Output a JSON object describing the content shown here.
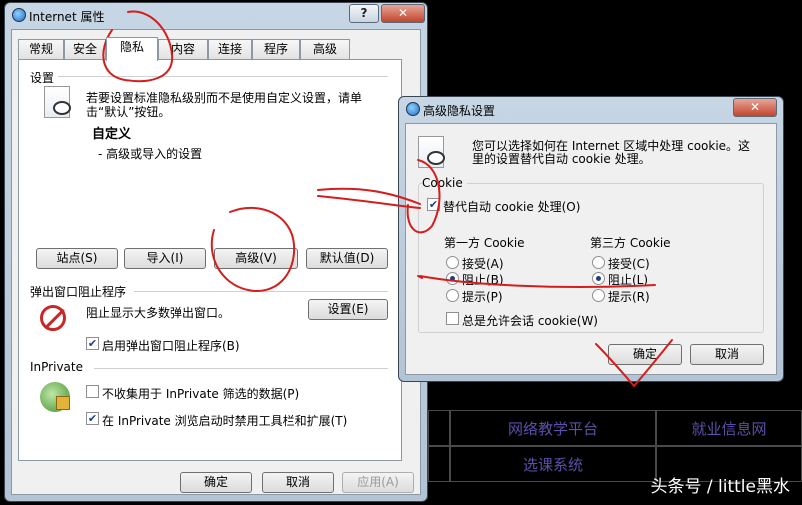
{
  "background": {
    "cells": [
      "网络教学平台",
      "就业信息网",
      "选课系统"
    ],
    "watermark": "头条号 / little黑水"
  },
  "internet_options": {
    "title": "Internet 属性",
    "help_btn": "?",
    "close_btn": "✕",
    "tabs": [
      "常规",
      "安全",
      "隐私",
      "内容",
      "连接",
      "程序",
      "高级"
    ],
    "settings": {
      "group": "设置",
      "desc_line1": "若要设置标准隐私级别而不是使用自定义设置，请单",
      "desc_line2": "击“默认”按钮。",
      "level": "自定义",
      "level_desc": "- 高级或导入的设置",
      "buttons": [
        "站点(S)",
        "导入(I)",
        "高级(V)",
        "默认值(D)"
      ]
    },
    "popup": {
      "group": "弹出窗口阻止程序",
      "desc": "阻止显示大多数弹出窗口。",
      "settings_btn": "设置(E)",
      "enable_label": "启用弹出窗口阻止程序(B)"
    },
    "inprivate": {
      "group": "InPrivate",
      "opt1": "不收集用于 InPrivate 筛选的数据(P)",
      "opt2": "在 InPrivate 浏览启动时禁用工具栏和扩展(T)"
    },
    "footer": {
      "ok": "确定",
      "cancel": "取消",
      "apply": "应用(A)"
    }
  },
  "advanced_privacy": {
    "title": "高级隐私设置",
    "close_btn": "✕",
    "intro_line1": "您可以选择如何在 Internet 区域中处理 cookie。这",
    "intro_line2": "里的设置替代自动 cookie 处理。",
    "cookie_group": "Cookie",
    "override_label": "替代自动 cookie 处理(O)",
    "first_party": {
      "header": "第一方 Cookie",
      "accept": "接受(A)",
      "block": "阻止(B)",
      "prompt": "提示(P)",
      "selected": "block"
    },
    "third_party": {
      "header": "第三方 Cookie",
      "accept": "接受(C)",
      "block": "阻止(L)",
      "prompt": "提示(R)",
      "selected": "block"
    },
    "session_label": "总是允许会话 cookie(W)",
    "ok": "确定",
    "cancel": "取消"
  }
}
